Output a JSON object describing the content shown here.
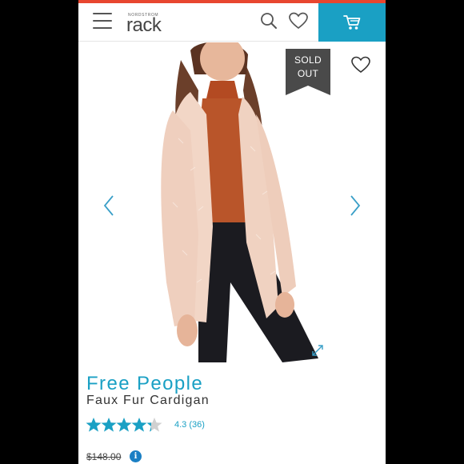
{
  "header": {
    "logo_small": "NORDSTROM",
    "logo_main": "rack",
    "menu_icon": "hamburger-menu-icon",
    "search_icon": "search-icon",
    "heart_icon": "heart-icon",
    "cart_icon": "cart-icon"
  },
  "product_image": {
    "badge": [
      "SOLD",
      "OUT"
    ],
    "prev_icon": "chevron-left-icon",
    "next_icon": "chevron-right-icon",
    "wishlist_icon": "heart-icon",
    "expand_icon": "expand-icon"
  },
  "product": {
    "brand": "Free People",
    "name": "Faux Fur Cardigan",
    "rating": 4.3,
    "rating_max": 5,
    "rating_label": "4.3 (36)",
    "price": "$148.00"
  },
  "colors": {
    "accent": "#1aa0c4",
    "top_strip": "#e8462f",
    "badge": "#4a4a4a"
  }
}
